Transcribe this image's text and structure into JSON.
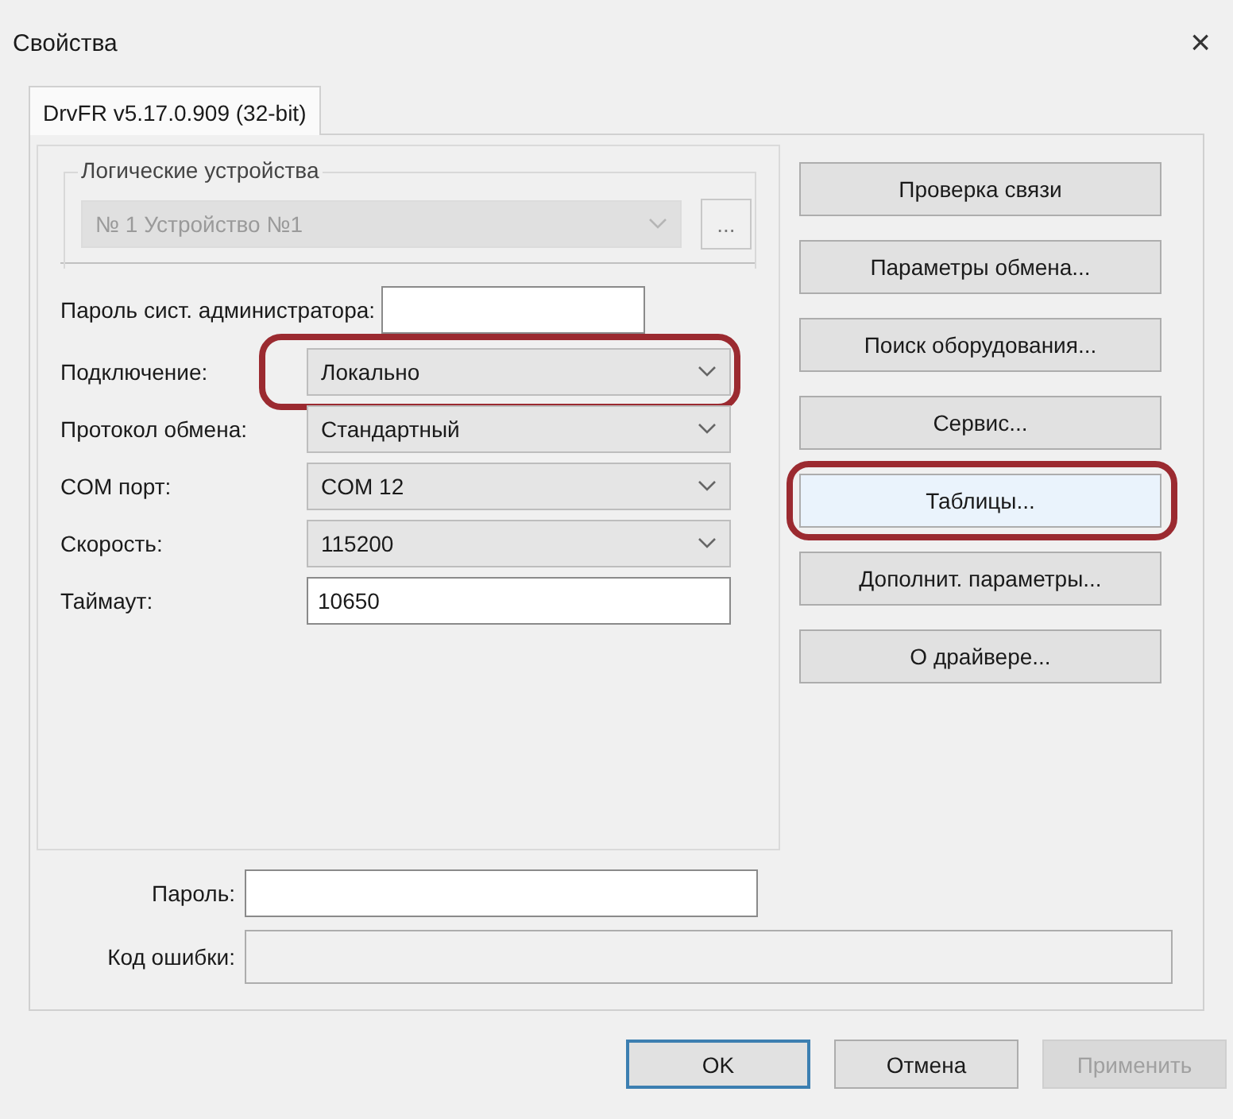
{
  "window": {
    "title": "Свойства",
    "close": "×"
  },
  "tabs": [
    {
      "label": "DrvFR v5.17.0.909 (32-bit)",
      "selected": true
    }
  ],
  "devices": {
    "title": "Логические устройства",
    "value": "№ 1 Устройство №1",
    "disabled": true,
    "browse": "..."
  },
  "admin_password": {
    "label": "Пароль сист. администратора:"
  },
  "fields": [
    {
      "label": "Подключение:",
      "kind": "combo",
      "value": "Локально",
      "highlighted": true
    },
    {
      "label": "Протокол обмена:",
      "kind": "combo",
      "value": "Стандартный",
      "highlighted": false
    },
    {
      "label": "COM порт:",
      "kind": "combo",
      "value": "COM 12",
      "highlighted": false
    },
    {
      "label": "Скорость:",
      "kind": "combo",
      "value": "115200",
      "highlighted": false
    },
    {
      "label": "Таймаут:",
      "kind": "text",
      "value": "10650",
      "highlighted": false
    }
  ],
  "actions": [
    {
      "label": "Проверка связи",
      "highlighted": false
    },
    {
      "label": "Параметры обмена...",
      "highlighted": false
    },
    {
      "label": "Поиск оборудования...",
      "highlighted": false
    },
    {
      "label": "Сервис...",
      "highlighted": false
    },
    {
      "label": "Таблицы...",
      "highlighted": true
    },
    {
      "label": "Дополнит. параметры...",
      "highlighted": false
    },
    {
      "label": "О драйвере...",
      "highlighted": false
    }
  ],
  "password": {
    "label": "Пароль:"
  },
  "error_code": {
    "label": "Код ошибки:"
  },
  "dialog_buttons": [
    {
      "label": "OK",
      "default": true,
      "disabled": false
    },
    {
      "label": "Отмена",
      "default": false,
      "disabled": false
    },
    {
      "label": "Применить",
      "default": false,
      "disabled": true
    }
  ]
}
